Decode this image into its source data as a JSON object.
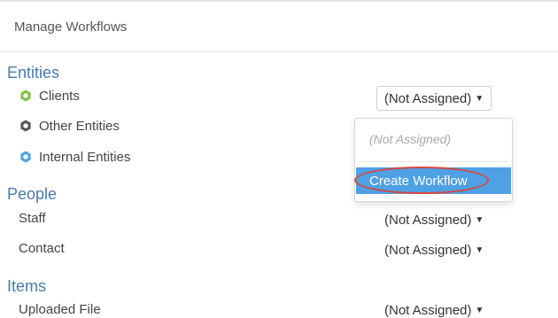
{
  "header": {
    "title": "Manage Workflows"
  },
  "sections": {
    "entities": {
      "heading": "Entities",
      "rows": [
        {
          "label": "Clients",
          "icon": "green-hexagon-icon",
          "color": "#7cc243"
        },
        {
          "label": "Other Entities",
          "icon": "dark-hexagon-icon",
          "color": "#555555"
        },
        {
          "label": "Internal Entities",
          "icon": "blue-hexagon-icon",
          "color": "#4fa0e4"
        }
      ]
    },
    "people": {
      "heading": "People",
      "rows": [
        {
          "label": "Staff",
          "value": "(Not Assigned)"
        },
        {
          "label": "Contact",
          "value": "(Not Assigned)"
        }
      ]
    },
    "items": {
      "heading": "Items",
      "rows": [
        {
          "label": "Uploaded File",
          "value": "(Not Assigned)"
        }
      ]
    }
  },
  "clients_select": {
    "value": "(Not Assigned)"
  },
  "dropdown": {
    "options": [
      {
        "label": "(Not Assigned)",
        "state": "muted"
      },
      {
        "label": "Create Workflow",
        "state": "highlighted"
      }
    ]
  },
  "colors": {
    "accent": "#4a7bab",
    "highlight": "#4fa0e4",
    "annotation": "#d9463f"
  }
}
